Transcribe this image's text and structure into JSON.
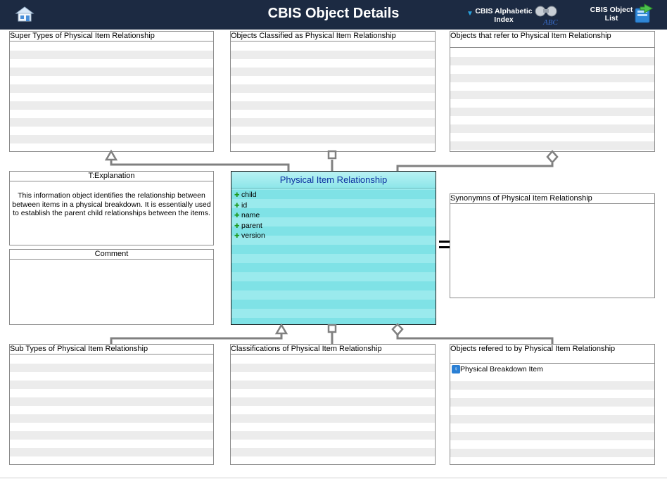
{
  "header": {
    "title": "CBIS Object Details",
    "home_icon": "home-icon",
    "alphabetic_index_label": "CBIS Alphabetic Index",
    "object_list_label": "CBIS Object List",
    "background": "#1c2a42"
  },
  "panels": {
    "super_types": {
      "label": "Super Types of Physical Item Relationship",
      "items": []
    },
    "classified_as": {
      "label": "Objects Classified as  Physical Item Relationship",
      "items": []
    },
    "refer_to": {
      "label": "Objects that refer to   Physical Item Relationship",
      "items": []
    },
    "explanation": {
      "label": "T:Explanation",
      "text": "This information object identifies the relationship between between items in a physical breakdown.  It is essentially used to establish the parent child relationships between the items."
    },
    "comment": {
      "label": "Comment",
      "text": ""
    },
    "synonyms": {
      "label": "Synonymns   of Physical Item Relationship",
      "items": []
    },
    "sub_types": {
      "label": "Sub Types of Physical Item Relationship",
      "items": []
    },
    "classifications": {
      "label": "Classifications of  Physical Item Relationship",
      "items": []
    },
    "referred_by": {
      "label": "Objects refered to by   Physical Item Relationship",
      "items": [
        {
          "label": "Physical Breakdown Item",
          "icon": "object-icon"
        }
      ]
    }
  },
  "entity": {
    "name": "Physical Item Relationship",
    "attributes": [
      "child",
      "id",
      "name",
      "parent",
      "version"
    ],
    "color": "#8ee6e9"
  }
}
